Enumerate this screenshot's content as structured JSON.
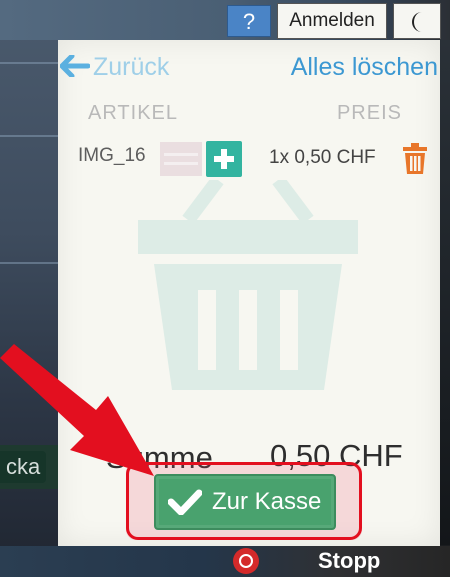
{
  "topbar": {
    "help_label": "?",
    "login_label": "Anmelden",
    "theme_icon": "moon-icon"
  },
  "cart": {
    "back_label": "Zurück",
    "clear_all_label": "Alles löschen",
    "columns": {
      "article": "ARTIKEL",
      "price": "PREIS"
    },
    "items": [
      {
        "name": "IMG_16",
        "quantity_price": "1x  0,50 CHF"
      }
    ],
    "total_label": "Summe",
    "total_value": "0,50 CHF",
    "checkout_label": "Zur Kasse"
  },
  "background": {
    "left_tab_partial": "cka"
  },
  "bottombar": {
    "stop_label": "Stopp"
  },
  "colors": {
    "accent_blue": "#3c98d2",
    "add_teal": "#33b4a0",
    "checkout_green": "#49a26e",
    "highlight_red": "#e30f1f",
    "trash_orange": "#e8762a"
  }
}
